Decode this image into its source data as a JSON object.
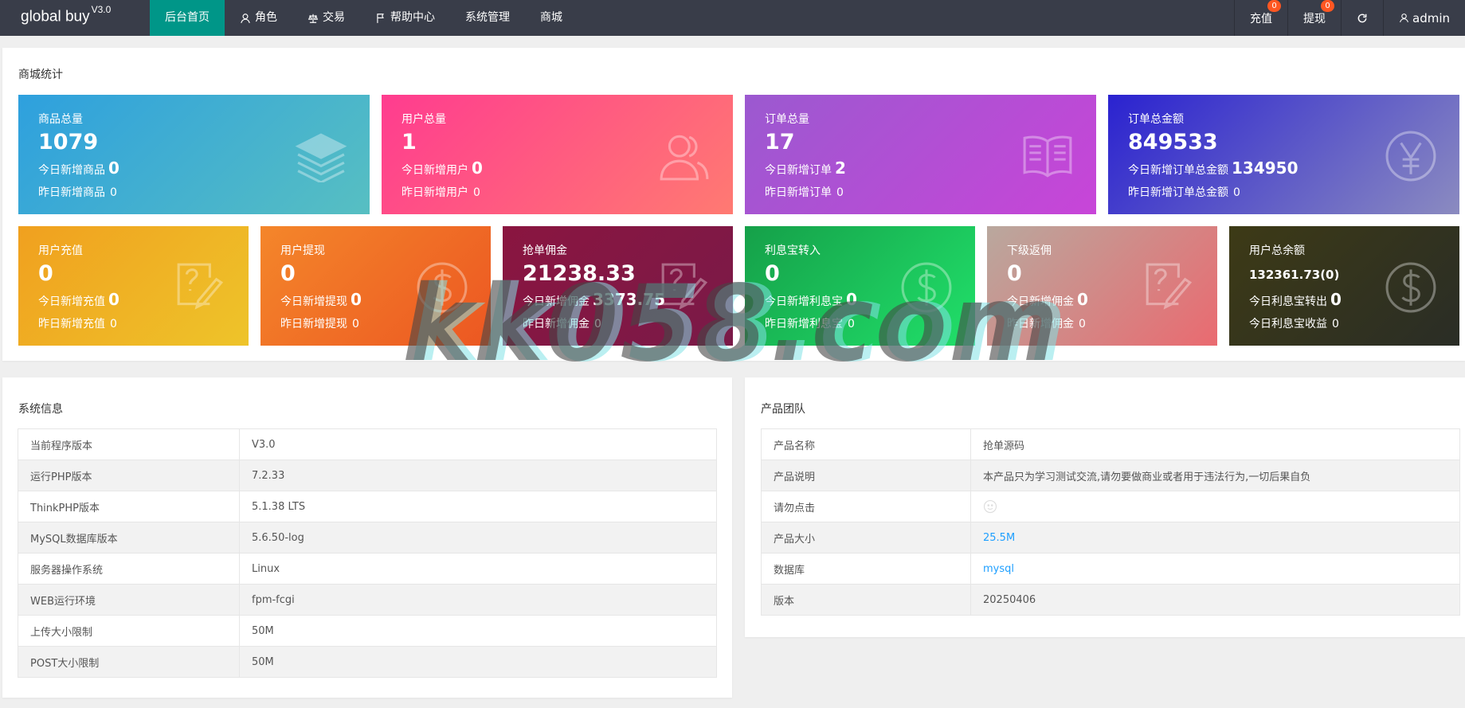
{
  "header": {
    "logo": "global buy",
    "version": "V3.0",
    "nav": [
      {
        "label": "后台首页",
        "icon": ""
      },
      {
        "label": "角色",
        "icon": "user-icon"
      },
      {
        "label": "交易",
        "icon": "scale-icon"
      },
      {
        "label": "帮助中心",
        "icon": "flag-icon"
      },
      {
        "label": "系统管理",
        "icon": ""
      },
      {
        "label": "商城",
        "icon": ""
      }
    ],
    "right": {
      "recharge_label": "充值",
      "recharge_badge": "0",
      "withdraw_label": "提现",
      "withdraw_badge": "0",
      "user_label": "admin"
    }
  },
  "stats": {
    "title": "商城统计",
    "row1": [
      {
        "title": "商品总量",
        "value": "1079",
        "today_label": "今日新增商品",
        "today_value": "0",
        "yesterday_label": "昨日新增商品",
        "yesterday_value": "0",
        "icon": "layers-icon",
        "colors": [
          "#2ea0de",
          "#57bfc2"
        ]
      },
      {
        "title": "用户总量",
        "value": "1",
        "today_label": "今日新增用户",
        "today_value": "0",
        "yesterday_label": "昨日新增用户",
        "yesterday_value": "0",
        "icon": "users-icon",
        "colors": [
          "#ff3c8f",
          "#ff7a72"
        ]
      },
      {
        "title": "订单总量",
        "value": "17",
        "today_label": "今日新增订单",
        "today_value": "2",
        "yesterday_label": "昨日新增订单",
        "yesterday_value": "0",
        "icon": "book-icon",
        "colors": [
          "#9b59d0",
          "#c845d8"
        ]
      },
      {
        "title": "订单总金额",
        "value": "849533",
        "today_label": "今日新增订单总金额",
        "today_value": "134950",
        "yesterday_label": "昨日新增订单总金额",
        "yesterday_value": "0",
        "icon": "yen-icon",
        "colors": [
          "#2a22d0",
          "#8b8bc0"
        ]
      }
    ],
    "row2": [
      {
        "title": "用户充值",
        "value": "0",
        "today_label": "今日新增充值",
        "today_value": "0",
        "yesterday_label": "昨日新增充值",
        "yesterday_value": "0",
        "icon": "edit-icon",
        "colors": [
          "#f0a01f",
          "#eec42a"
        ]
      },
      {
        "title": "用户提现",
        "value": "0",
        "today_label": "今日新增提现",
        "today_value": "0",
        "yesterday_label": "昨日新增提现",
        "yesterday_value": "0",
        "icon": "dollar-icon",
        "colors": [
          "#f4862a",
          "#ec5722"
        ]
      },
      {
        "title": "抢单佣金",
        "value": "21238.33",
        "today_label": "今日新增佣金",
        "today_value": "3373.75",
        "yesterday_label": "昨日新增佣金",
        "yesterday_value": "0",
        "icon": "edit-icon",
        "colors": [
          "#8a1540",
          "#7a1a48"
        ]
      },
      {
        "title": "利息宝转入",
        "value": "0",
        "today_label": "今日新增利息宝",
        "today_value": "0",
        "yesterday_label": "昨日新增利息宝",
        "yesterday_value": "0",
        "icon": "dollar-icon",
        "colors": [
          "#15a049",
          "#21e06a"
        ]
      },
      {
        "title": "下级返佣",
        "value": "0",
        "today_label": "今日新增佣金",
        "today_value": "0",
        "yesterday_label": "昨日新增佣金",
        "yesterday_value": "0",
        "icon": "edit-icon",
        "colors": [
          "#b9a89e",
          "#ea6a70"
        ]
      },
      {
        "title": "用户总余额",
        "value": "132361.73(0)",
        "today_label": "今日利息宝转出",
        "today_value": "0",
        "yesterday_label": "今日利息宝收益",
        "yesterday_value": "0",
        "icon": "dollar-icon",
        "colors": [
          "#3d3a16",
          "#2a2d26"
        ]
      }
    ]
  },
  "system": {
    "title": "系统信息",
    "rows": [
      {
        "label": "当前程序版本",
        "value": "V3.0"
      },
      {
        "label": "运行PHP版本",
        "value": "7.2.33"
      },
      {
        "label": "ThinkPHP版本",
        "value": "5.1.38 LTS"
      },
      {
        "label": "MySQL数据库版本",
        "value": "5.6.50-log"
      },
      {
        "label": "服务器操作系统",
        "value": "Linux"
      },
      {
        "label": "WEB运行环境",
        "value": "fpm-fcgi"
      },
      {
        "label": "上传大小限制",
        "value": "50M"
      },
      {
        "label": "POST大小限制",
        "value": "50M"
      }
    ]
  },
  "team": {
    "title": "产品团队",
    "rows": [
      {
        "label": "产品名称",
        "value": "抢单源码",
        "link": false
      },
      {
        "label": "产品说明",
        "value": "本产品只为学习测试交流,请勿要做商业或者用于违法行为,一切后果自负",
        "link": false
      },
      {
        "label": "请勿点击",
        "value": "",
        "link": false,
        "icon": "smile-icon"
      },
      {
        "label": "产品大小",
        "value": "25.5M",
        "link": true
      },
      {
        "label": "数据库",
        "value": "mysql",
        "link": true
      },
      {
        "label": "版本",
        "value": "20250406",
        "link": false
      }
    ]
  },
  "watermark": "kk058.com"
}
